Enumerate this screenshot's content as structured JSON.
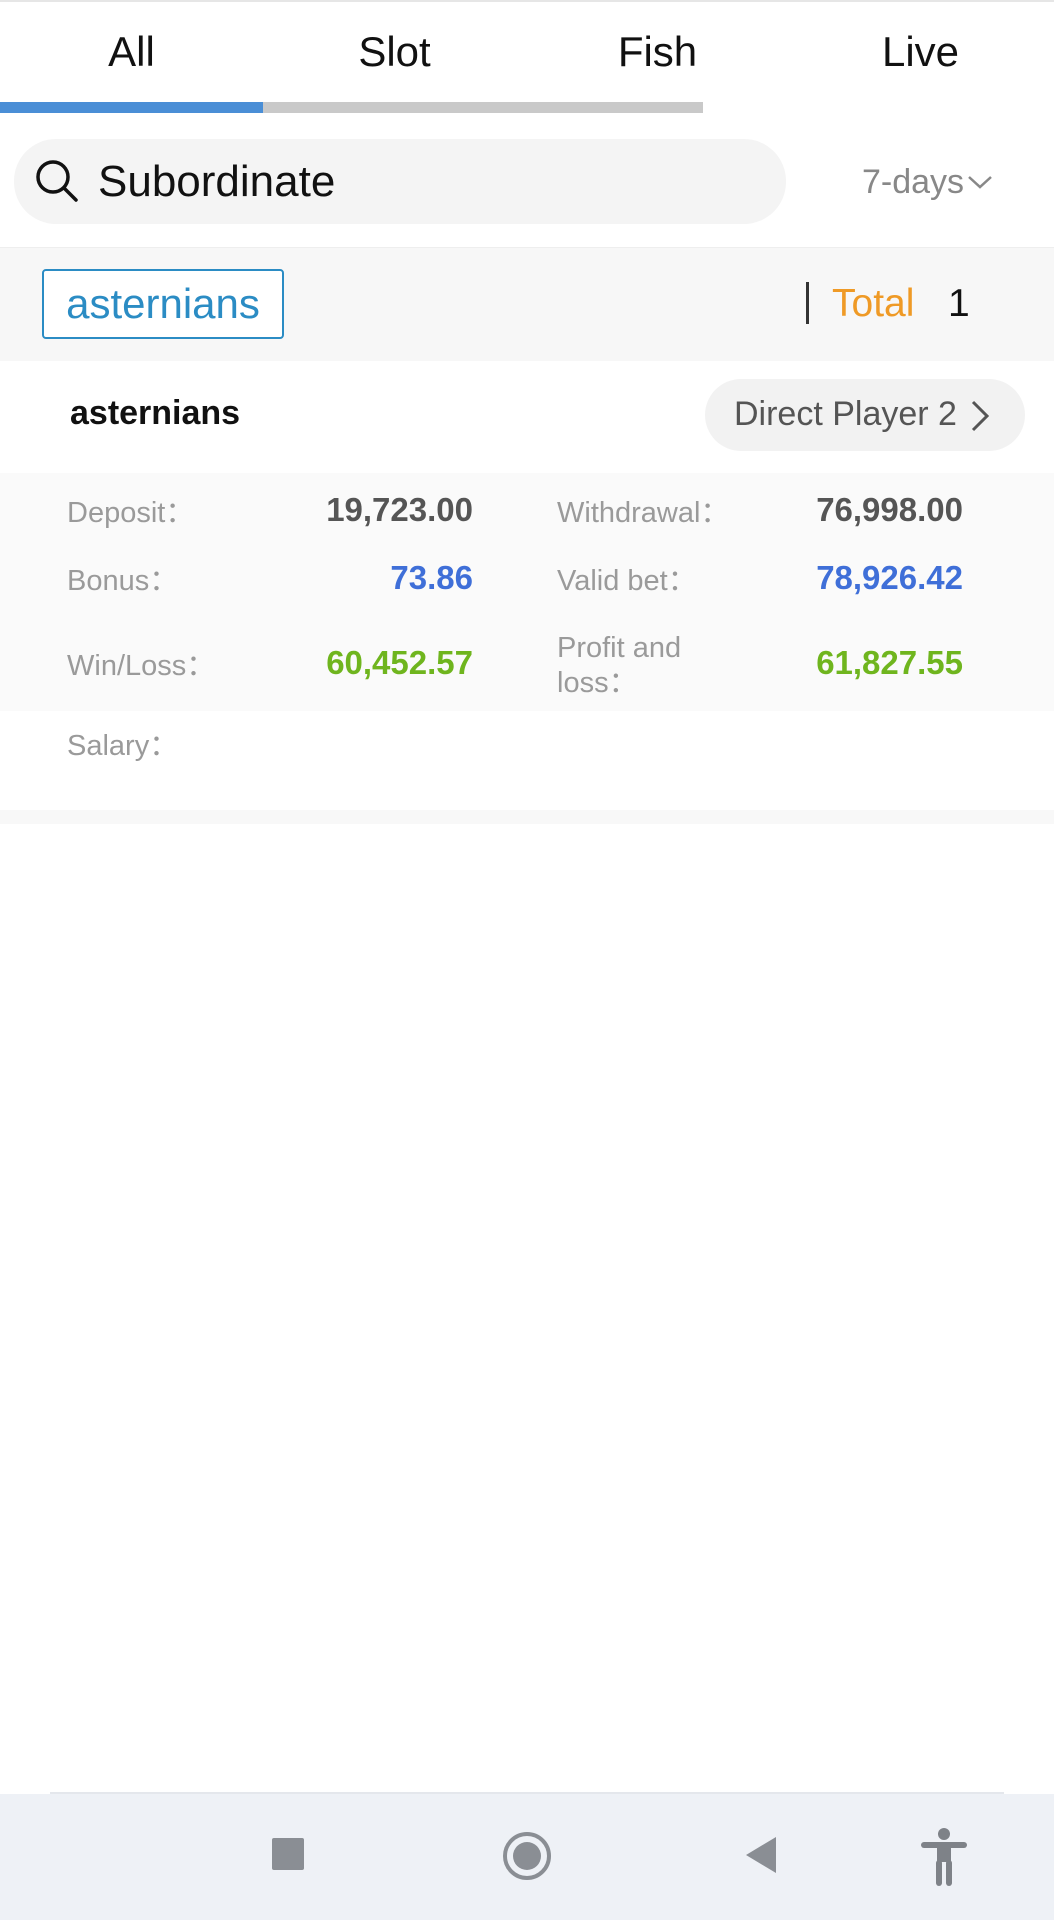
{
  "tabs": {
    "items": [
      {
        "label": "All"
      },
      {
        "label": "Slot"
      },
      {
        "label": "Fish"
      },
      {
        "label": "Live"
      }
    ],
    "active_index": 0,
    "accent_color": "#4a8ed6"
  },
  "search": {
    "icon": "search-icon",
    "value": "Subordinate",
    "range_label": "7-days",
    "range_icon": "chevron-down-icon"
  },
  "filter": {
    "chip_label": "asternians",
    "total_label": "Total",
    "total_value": "1",
    "total_color": "#ef9a26"
  },
  "card": {
    "name": "asternians",
    "direct_button_label": "Direct Player 2",
    "direct_button_icon": "chevron-right-icon",
    "stats": {
      "deposit_label": "Deposit：",
      "deposit_value": "19,723.00",
      "withdrawal_label": "Withdrawal：",
      "withdrawal_value": "76,998.00",
      "bonus_label": "Bonus：",
      "bonus_value": "73.86",
      "valid_bet_label": "Valid bet：",
      "valid_bet_value": "78,926.42",
      "win_loss_label": "Win/Loss：",
      "win_loss_value": "60,452.57",
      "profit_loss_label_line1": "Profit and",
      "profit_loss_label_line2": "loss：",
      "profit_loss_value": "61,827.55",
      "salary_label": "Salary："
    },
    "colors": {
      "neutral": "#555555",
      "blue": "#3f6fd8",
      "green": "#6fb51e"
    }
  },
  "system_nav": {
    "icons": [
      "recents-square-icon",
      "home-circle-icon",
      "back-triangle-icon",
      "accessibility-icon"
    ]
  }
}
